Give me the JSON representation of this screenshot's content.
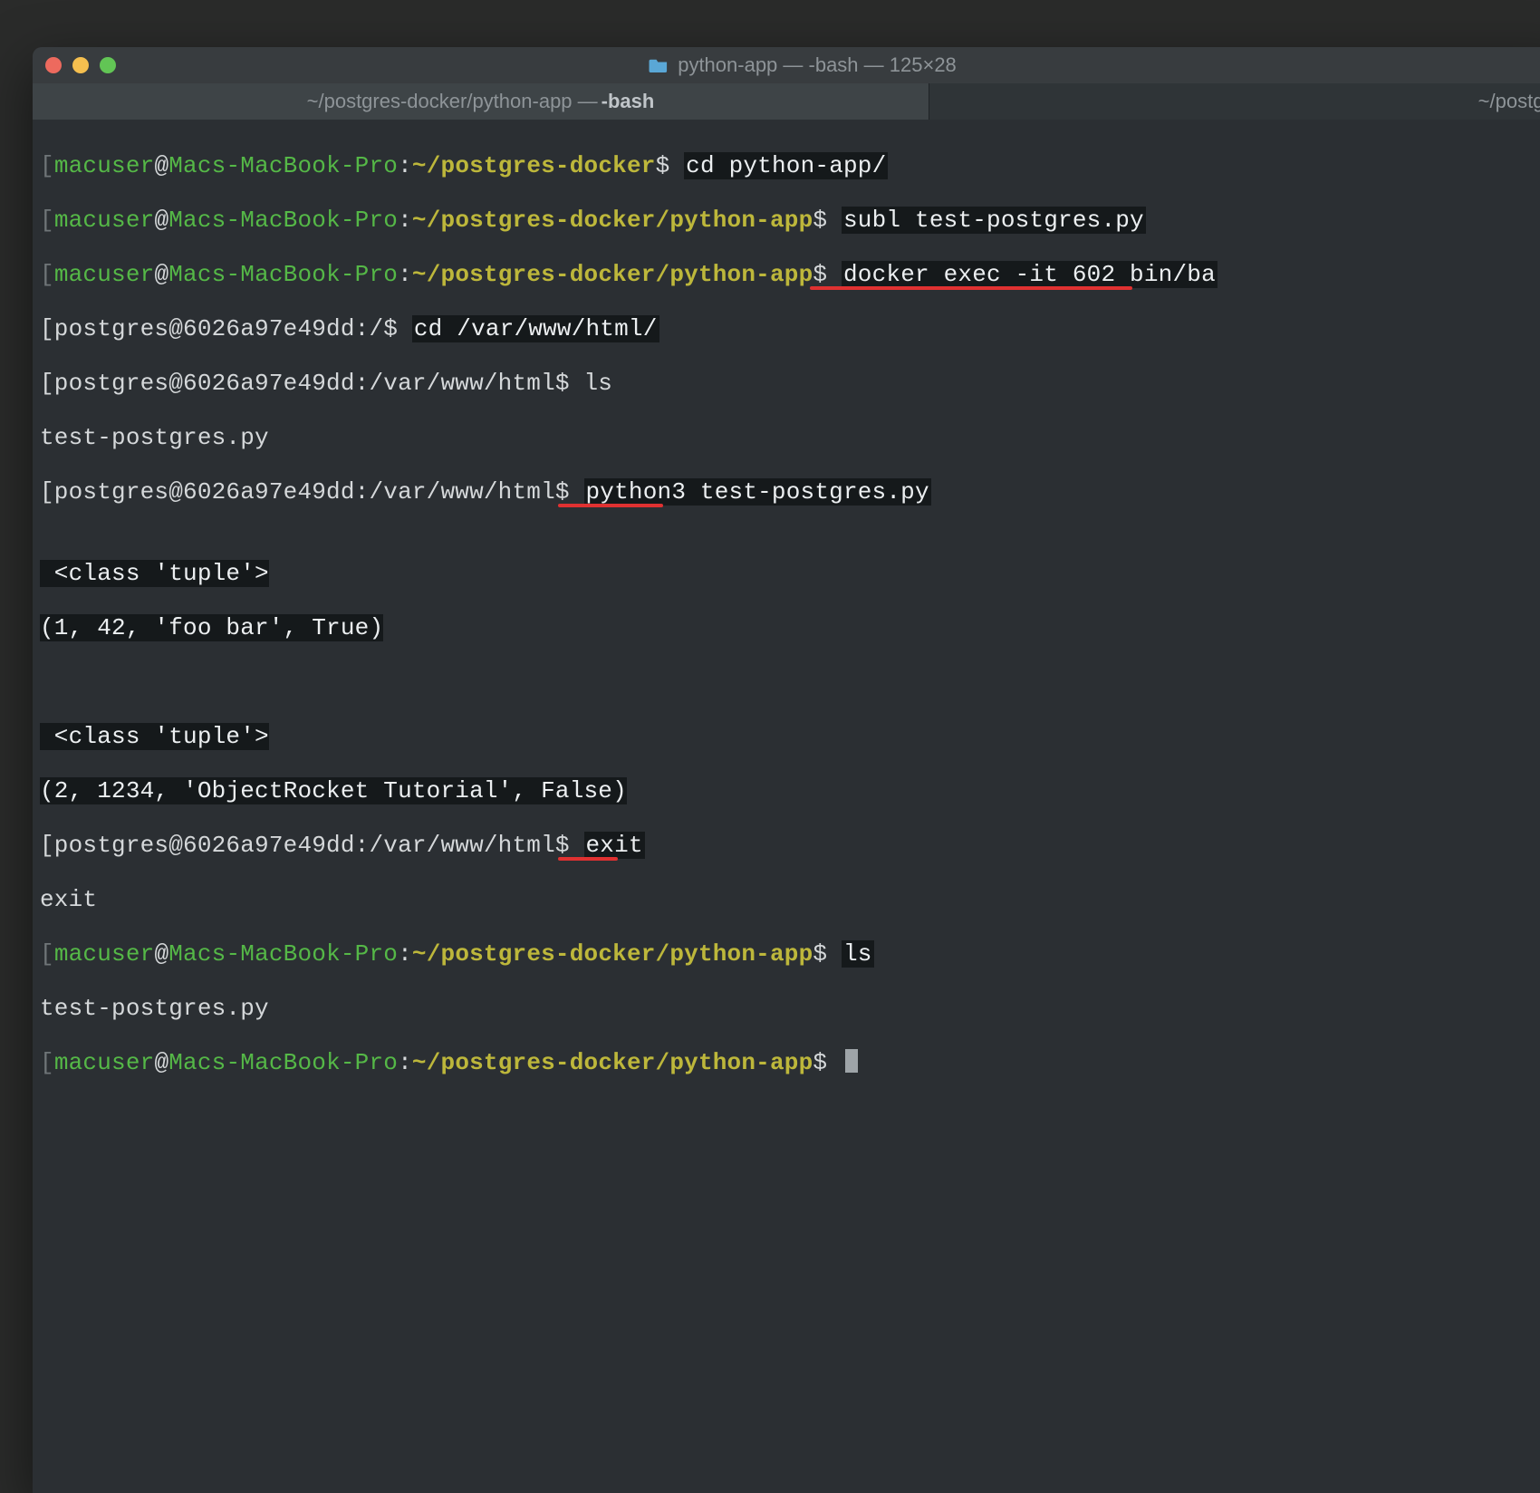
{
  "window": {
    "title": "python-app — -bash — 125×28"
  },
  "tabs": {
    "active_prefix": "~/postgres-docker/python-app — ",
    "active_bold": "-bash",
    "inactive": "~/postgres"
  },
  "lines": {
    "l1_open": "[",
    "l1_user": "macuser",
    "l1_at": "@",
    "l1_host": "Macs-MacBook-Pro",
    "l1_colon": ":",
    "l1_path": "~/postgres-docker",
    "l1_dollar": "$ ",
    "l1_cmd": "cd python-app/",
    "l2_open": "[",
    "l2_user": "macuser",
    "l2_at": "@",
    "l2_host": "Macs-MacBook-Pro",
    "l2_colon": ":",
    "l2_path": "~/postgres-docker/python-app",
    "l2_dollar": "$ ",
    "l2_cmd": "subl test-postgres.py",
    "l3_open": "[",
    "l3_user": "macuser",
    "l3_at": "@",
    "l3_host": "Macs-MacBook-Pro",
    "l3_colon": ":",
    "l3_path": "~/postgres-docker/python-app",
    "l3_dollar": "$ ",
    "l3_cmd": "docker exec -it 602 bin/ba",
    "l4": "[postgres@6026a97e49dd:/$ ",
    "l4_cmd": "cd /var/www/html/",
    "l5": "[postgres@6026a97e49dd:/var/www/html$ ls",
    "l6": "test-postgres.py",
    "l7": "[postgres@6026a97e49dd:/var/www/html$ ",
    "l7_cmd": "python3 test-postgres.py",
    "l8": "",
    "l9a": " <class 'tuple'>",
    "l9b": "(1, 42, 'foo bar', True)",
    "l10": "",
    "l11a": " <class 'tuple'>",
    "l11b": "(2, 1234, 'ObjectRocket Tutorial', False)",
    "l12": "[postgres@6026a97e49dd:/var/www/html$ ",
    "l12_cmd": "exit",
    "l13": "exit",
    "l14_open": "[",
    "l14_user": "macuser",
    "l14_at": "@",
    "l14_host": "Macs-MacBook-Pro",
    "l14_colon": ":",
    "l14_path": "~/postgres-docker/python-app",
    "l14_dollar": "$ ",
    "l14_cmd": "ls",
    "l15": "test-postgres.py",
    "l16_open": "[",
    "l16_user": "macuser",
    "l16_at": "@",
    "l16_host": "Macs-MacBook-Pro",
    "l16_colon": ":",
    "l16_path": "~/postgres-docker/python-app",
    "l16_dollar": "$ "
  }
}
